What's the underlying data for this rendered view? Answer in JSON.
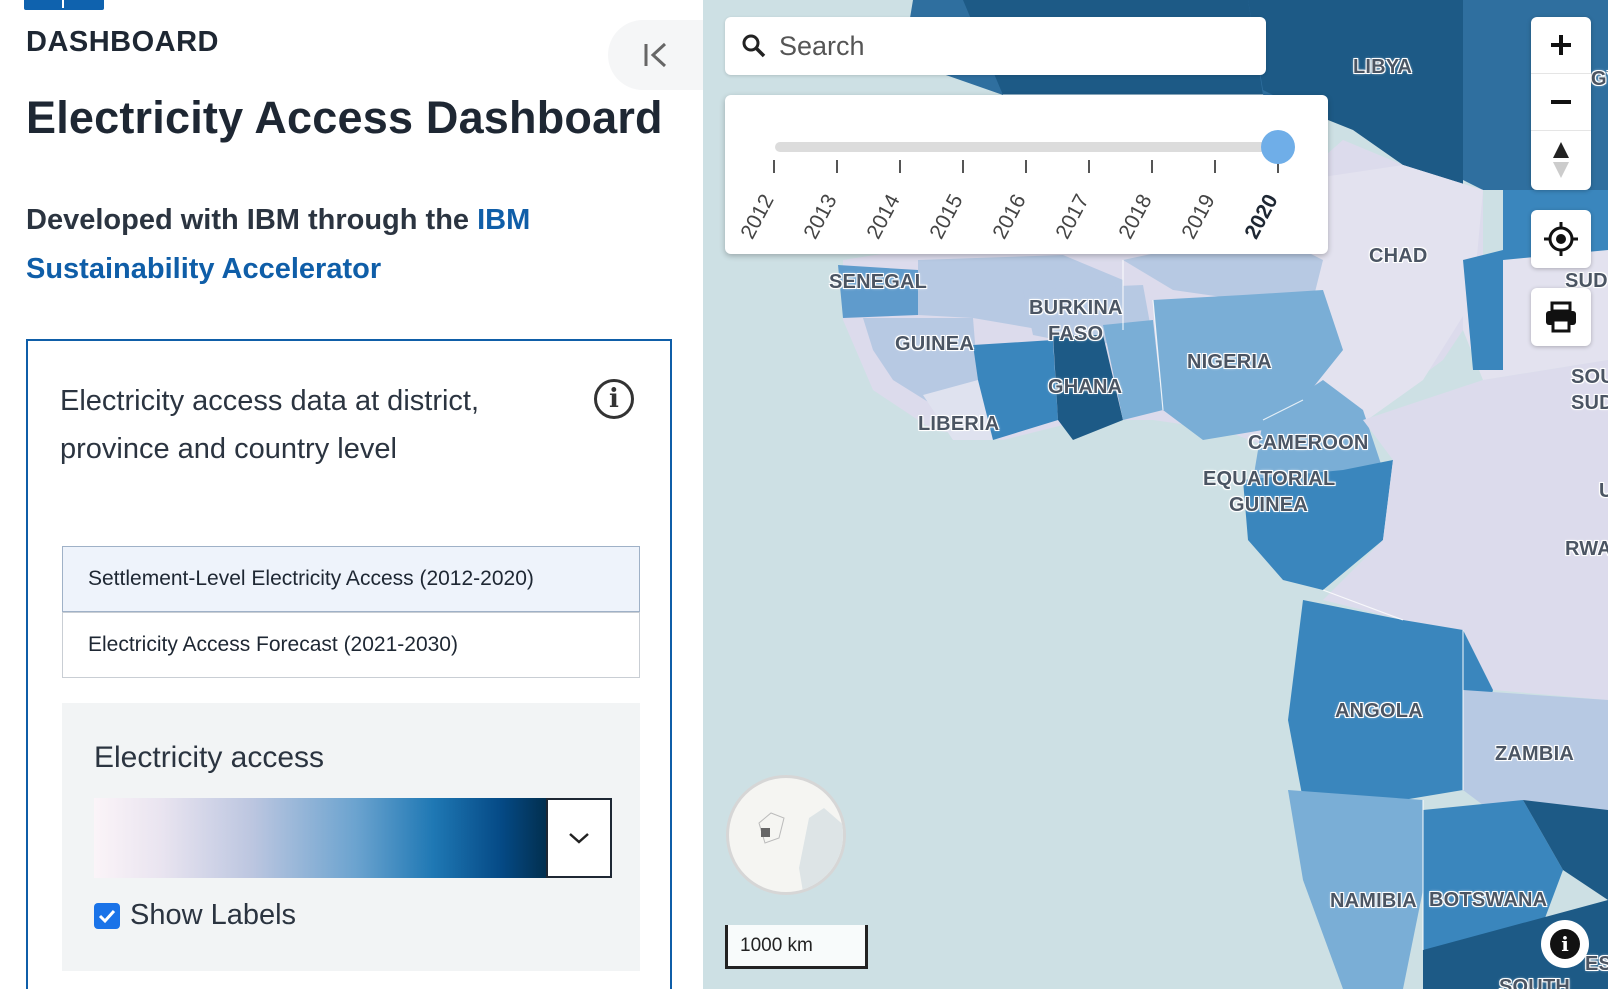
{
  "sidebar": {
    "brand": "DASHBOARD",
    "title": "Electricity Access Dashboard",
    "subtitle_prefix": "Developed with IBM through the ",
    "subtitle_link": "IBM Sustainability Accelerator",
    "card": {
      "description": "Electricity access data at district, province and country level",
      "layers": [
        {
          "label": "Settlement-Level Electricity Access (2012-2020)",
          "selected": true
        },
        {
          "label": "Electricity Access Forecast (2021-2030)",
          "selected": false
        }
      ],
      "legend_title": "Electricity access",
      "show_labels_label": "Show Labels",
      "show_labels_checked": true
    }
  },
  "map": {
    "search_placeholder": "Search",
    "time_slider": {
      "years": [
        "2012",
        "2013",
        "2014",
        "2015",
        "2016",
        "2017",
        "2018",
        "2019",
        "2020"
      ],
      "selected": "2020"
    },
    "scale_label": "1000 km",
    "country_labels": {
      "libya": "LIBYA",
      "chad": "CHAD",
      "senegal": "SENEGAL",
      "burkina_1": "BURKINA",
      "burkina_2": "FASO",
      "guinea": "GUINEA",
      "ghana": "GHANA",
      "nigeria": "NIGERIA",
      "liberia": "LIBERIA",
      "cameroon": "CAMEROON",
      "eq_guinea_1": "EQUATORIAL",
      "eq_guinea_2": "GUINEA",
      "angola": "ANGOLA",
      "zambia": "ZAMBIA",
      "namibia": "NAMIBIA",
      "botswana": "BOTSWANA",
      "sud": "SUD",
      "sou": "SOU",
      "sud2": "SUD",
      "rwa": "RWA",
      "gy": "GY",
      "u": "U",
      "es": "ES",
      "south": "SOUTH"
    },
    "colors": {
      "ocean": "#cde0e4",
      "dark": "#1d5a86",
      "mid": "#3a86bd",
      "light": "#7aaed6",
      "pale": "#b7c9e3",
      "lavender": "#dcdbec"
    }
  }
}
